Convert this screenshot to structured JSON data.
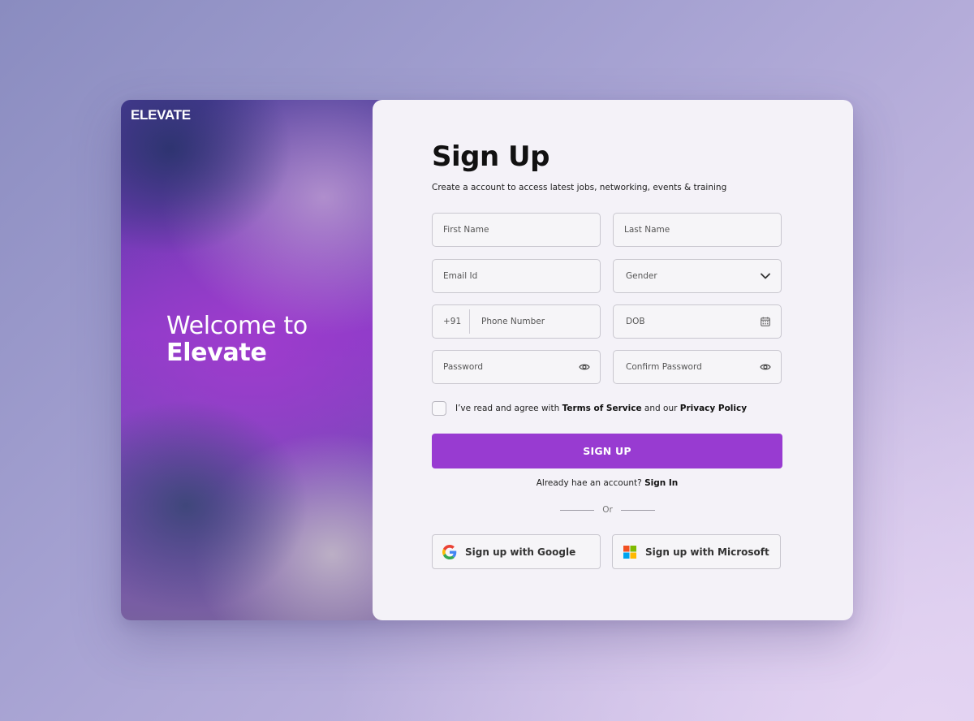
{
  "brand": {
    "logo_text": "ELEVATE",
    "welcome_line1": "Welcome to",
    "welcome_line2": "Elevate"
  },
  "form": {
    "title": "Sign Up",
    "subtitle": "Create a account to access latest jobs, networking, events & training",
    "first_name_placeholder": "First Name",
    "last_name_placeholder": "Last Name",
    "email_placeholder": "Email Id",
    "gender_label": "Gender",
    "phone_prefix": "+91",
    "phone_placeholder": "Phone Number",
    "dob_label": "DOB",
    "password_placeholder": "Password",
    "confirm_password_placeholder": "Confirm Password",
    "terms_prefix": "I’ve read and agree with ",
    "terms_link": "Terms of Service",
    "terms_middle": " and our ",
    "privacy_link": "Privacy Policy",
    "submit_label": "SIGN UP",
    "have_account_text": "Already hae an account? ",
    "sign_in_link": "Sign In",
    "divider_text": "Or",
    "google_label": "Sign up with Google",
    "microsoft_label": "Sign up with Microsoft"
  },
  "icons": {
    "gender": "chevron-down-icon",
    "dob": "calendar-icon",
    "password": "eye-icon",
    "confirm_password": "eye-icon",
    "google": "google-icon",
    "microsoft": "microsoft-icon"
  },
  "colors": {
    "accent": "#983bd1",
    "panel_background": "#f4f2f8"
  }
}
